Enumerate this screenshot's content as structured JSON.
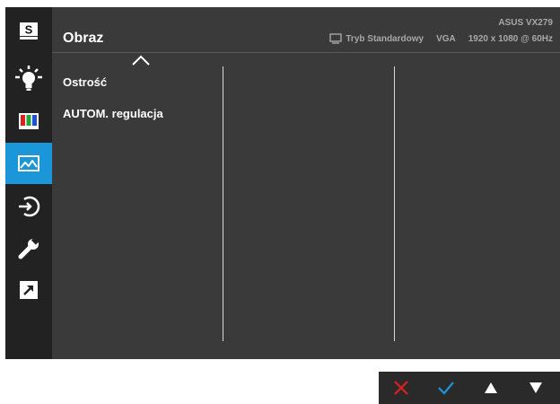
{
  "header": {
    "title": "Obraz",
    "model": "ASUS VX279",
    "mode": "Tryb Standardowy",
    "input": "VGA",
    "resolution": "1920 x 1080 @ 60Hz"
  },
  "sidebar": {
    "items": [
      {
        "name": "splendid",
        "icon": "splendid-s-icon",
        "label": "S"
      },
      {
        "name": "blue-light-filter",
        "icon": "lightbulb-icon"
      },
      {
        "name": "color",
        "icon": "color-bars-icon"
      },
      {
        "name": "image",
        "icon": "image-landscape-icon",
        "active": true
      },
      {
        "name": "input-select",
        "icon": "input-select-icon"
      },
      {
        "name": "system-setup",
        "icon": "wrench-icon"
      },
      {
        "name": "shortcut",
        "icon": "shortcut-arrow-icon"
      }
    ],
    "active_color": "#1a96d9"
  },
  "menu": {
    "items": [
      "Ostrość",
      "AUTOM. regulacja"
    ]
  },
  "nav": {
    "buttons": [
      {
        "name": "close",
        "icon": "x-icon",
        "color": "#e02020"
      },
      {
        "name": "confirm",
        "icon": "check-icon",
        "color": "#1a96d9"
      },
      {
        "name": "up",
        "icon": "triangle-up-icon",
        "color": "#ffffff"
      },
      {
        "name": "down",
        "icon": "triangle-down-icon",
        "color": "#ffffff"
      }
    ]
  }
}
